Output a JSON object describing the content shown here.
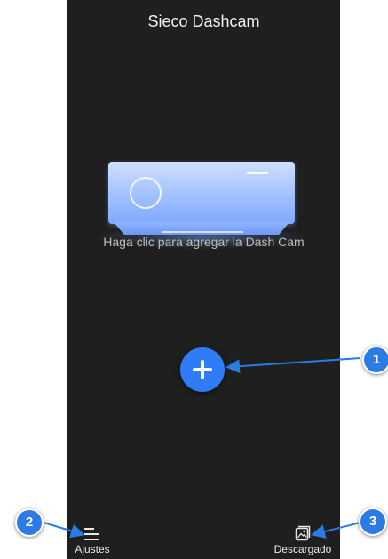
{
  "app": {
    "title": "Sieco Dashcam"
  },
  "main": {
    "hint": "Haga clic para agregar la Dash Cam",
    "add_icon": "plus-icon"
  },
  "bottom_nav": [
    {
      "label": "Ajustes",
      "icon": "menu-icon"
    },
    {
      "label": "Descargado",
      "icon": "gallery-icon"
    }
  ],
  "callouts": [
    "1",
    "2",
    "3"
  ],
  "colors": {
    "background": "#1f1f1f",
    "accent": "#2f7cf6",
    "callout": "#2c7be5",
    "device": "#a8c6ff"
  }
}
